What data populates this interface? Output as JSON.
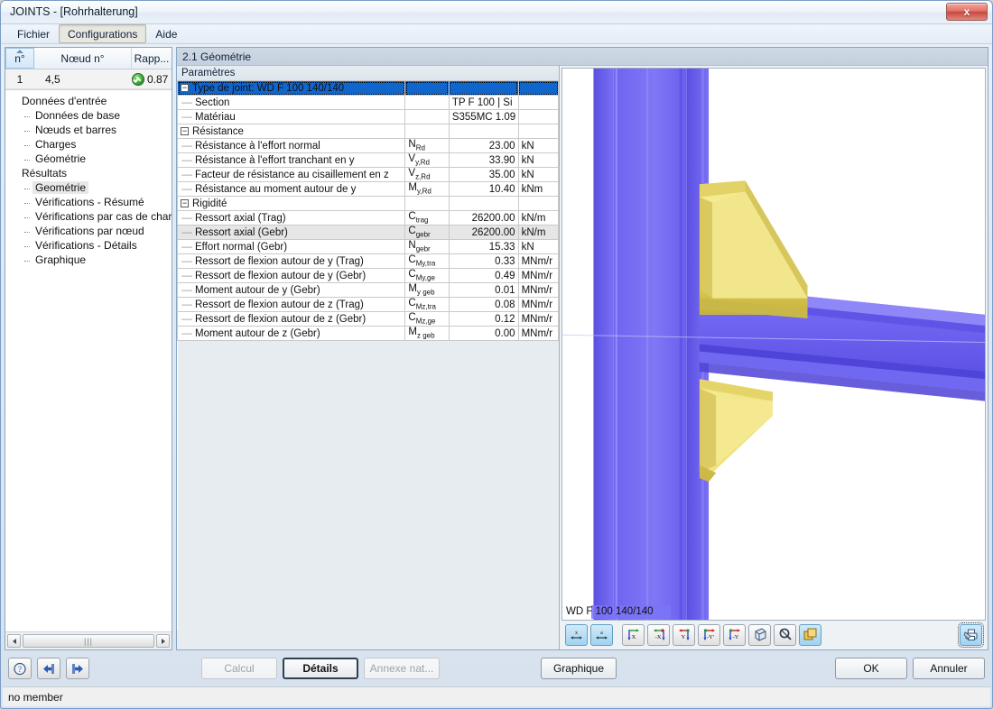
{
  "window": {
    "title": "JOINTS - [Rohrhalterung]",
    "close_label": "x"
  },
  "menubar": {
    "items": [
      {
        "label": "Fichier",
        "pressed": false
      },
      {
        "label": "Configurations",
        "pressed": true
      },
      {
        "label": "Aide",
        "pressed": false
      }
    ]
  },
  "node_table": {
    "columns": [
      {
        "label": "n°",
        "sorted": true
      },
      {
        "label": "Nœud n°",
        "sorted": false
      },
      {
        "label": "Rapp...",
        "sorted": false
      }
    ],
    "rows": [
      {
        "no": "1",
        "node": "4,5",
        "ratio": "0.87",
        "status": "ok"
      }
    ]
  },
  "nav_tree": {
    "groups": [
      {
        "label": "Données d'entrée",
        "children": [
          {
            "label": "Données de base",
            "selected": false
          },
          {
            "label": "Nœuds et barres",
            "selected": false
          },
          {
            "label": "Charges",
            "selected": false
          },
          {
            "label": "Géométrie",
            "selected": false
          }
        ]
      },
      {
        "label": "Résultats",
        "children": [
          {
            "label": "Geométrie",
            "selected": true
          },
          {
            "label": "Vérifications - Résumé",
            "selected": false
          },
          {
            "label": "Vérifications par cas de charge",
            "selected": false
          },
          {
            "label": "Vérifications par nœud",
            "selected": false
          },
          {
            "label": "Vérifications - Détails",
            "selected": false
          },
          {
            "label": "Graphique",
            "selected": false
          }
        ]
      }
    ]
  },
  "main": {
    "header": "2.1 Géométrie",
    "grid_title": "Paramètres",
    "grid_rows": [
      {
        "kind": "group",
        "selected": true,
        "expander": "−",
        "label": "Type de joint: WD F 100 140/140",
        "sym": "",
        "sym_sub": "",
        "value": "",
        "unit": ""
      },
      {
        "kind": "item",
        "selected": false,
        "label": "Section",
        "sym": "",
        "sym_sub": "",
        "value": "TP F 100 | Si",
        "unit": "",
        "value_left": true
      },
      {
        "kind": "item",
        "selected": false,
        "label": "Matériau",
        "sym": "",
        "sym_sub": "",
        "value": "S355MC 1.09",
        "unit": "",
        "value_left": true
      },
      {
        "kind": "group",
        "selected": false,
        "expander": "−",
        "label": "Résistance",
        "sym": "",
        "sym_sub": "",
        "value": "",
        "unit": ""
      },
      {
        "kind": "item",
        "selected": false,
        "label": "Résistance à l'effort normal",
        "sym": "N",
        "sym_sub": "Rd",
        "value": "23.00",
        "unit": "kN"
      },
      {
        "kind": "item",
        "selected": false,
        "label": "Résistance à l'effort tranchant en y",
        "sym": "V",
        "sym_sub": "y,Rd",
        "value": "33.90",
        "unit": "kN"
      },
      {
        "kind": "item",
        "selected": false,
        "label": "Facteur de résistance au cisaillement en z",
        "sym": "V",
        "sym_sub": "z,Rd",
        "value": "35.00",
        "unit": "kN"
      },
      {
        "kind": "item",
        "selected": false,
        "label": "Résistance au moment autour de y",
        "sym": "M",
        "sym_sub": "y,Rd",
        "value": "10.40",
        "unit": "kNm"
      },
      {
        "kind": "group",
        "selected": false,
        "expander": "−",
        "label": "Rigidité",
        "sym": "",
        "sym_sub": "",
        "value": "",
        "unit": ""
      },
      {
        "kind": "item",
        "selected": false,
        "label": "Ressort axial (Trag)",
        "sym": "C",
        "sym_sub": "trag",
        "value": "26200.00",
        "unit": "kN/m"
      },
      {
        "kind": "item",
        "selected": false,
        "highlight": true,
        "label": "Ressort axial (Gebr)",
        "sym": "C",
        "sym_sub": "gebr",
        "value": "26200.00",
        "unit": "kN/m"
      },
      {
        "kind": "item",
        "selected": false,
        "label": "Effort normal (Gebr)",
        "sym": "N",
        "sym_sub": "gebr",
        "value": "15.33",
        "unit": "kN"
      },
      {
        "kind": "item",
        "selected": false,
        "label": "Ressort de flexion autour de y (Trag)",
        "sym": "C",
        "sym_sub": "My,tra",
        "value": "0.33",
        "unit": "MNm/r"
      },
      {
        "kind": "item",
        "selected": false,
        "label": "Ressort de flexion autour de y (Gebr)",
        "sym": "C",
        "sym_sub": "My,ge",
        "value": "0.49",
        "unit": "MNm/r"
      },
      {
        "kind": "item",
        "selected": false,
        "label": "Moment autour de y (Gebr)",
        "sym": "M",
        "sym_sub": "y geb",
        "value": "0.01",
        "unit": "MNm/r"
      },
      {
        "kind": "item",
        "selected": false,
        "label": "Ressort de flexion autour de z (Trag)",
        "sym": "C",
        "sym_sub": "Mz,tra",
        "value": "0.08",
        "unit": "MNm/r"
      },
      {
        "kind": "item",
        "selected": false,
        "label": "Ressort de flexion autour de z (Gebr)",
        "sym": "C",
        "sym_sub": "Mz,ge",
        "value": "0.12",
        "unit": "MNm/r"
      },
      {
        "kind": "item",
        "selected": false,
        "label": "Moment autour de z (Gebr)",
        "sym": "M",
        "sym_sub": "z geb",
        "value": "0.00",
        "unit": "MNm/r"
      }
    ]
  },
  "viewport": {
    "caption": "WD F 100 140/140",
    "colors": {
      "member": "#6f63f0",
      "plate": "#f0e27a",
      "background": "#ffffff"
    },
    "toolbar": [
      {
        "name": "dimension-x-button",
        "icon": "dimension-x-icon",
        "active": true
      },
      {
        "name": "dimension-a-button",
        "icon": "dimension-a-icon",
        "active": true
      },
      {
        "name": "view-x-button",
        "icon": "axis-x-icon",
        "active": false
      },
      {
        "name": "view-minus-x-button",
        "icon": "axis-minus-x-icon",
        "active": false
      },
      {
        "name": "view-y-button",
        "icon": "axis-y-icon",
        "active": false
      },
      {
        "name": "view-minus-y-prime-button",
        "icon": "axis-minus-y-prime-icon",
        "active": false
      },
      {
        "name": "view-minus-y-button",
        "icon": "axis-minus-y-icon",
        "active": false
      },
      {
        "name": "isometric-view-button",
        "icon": "cube-icon",
        "active": false
      },
      {
        "name": "zoom-reset-button",
        "icon": "magnifier-icon",
        "active": false
      },
      {
        "name": "render-mode-button",
        "icon": "layers-icon",
        "active": true
      },
      {
        "name": "print-view-button",
        "icon": "print-icon",
        "active": true
      }
    ]
  },
  "bottom": {
    "tools": [
      {
        "name": "help-button",
        "icon": "question-icon"
      },
      {
        "name": "previous-button",
        "icon": "arrow-left-icon"
      },
      {
        "name": "next-button",
        "icon": "arrow-right-icon"
      }
    ],
    "buttons": [
      {
        "label": "Calcul",
        "state": "disabled",
        "name": "calcul-button"
      },
      {
        "label": "Détails",
        "state": "default",
        "name": "details-button"
      },
      {
        "label": "Annexe nat...",
        "state": "disabled",
        "name": "annexe-nationale-button"
      },
      {
        "label": "Graphique",
        "state": "normal",
        "name": "graphique-button"
      },
      {
        "label": "OK",
        "state": "normal",
        "name": "ok-button"
      },
      {
        "label": "Annuler",
        "state": "normal",
        "name": "annuler-button"
      }
    ]
  },
  "statusbar": {
    "text": "no member"
  }
}
